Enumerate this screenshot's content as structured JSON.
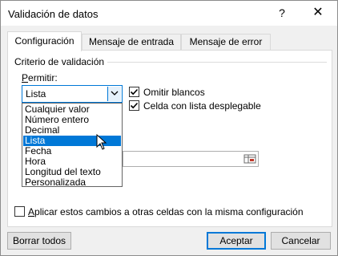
{
  "window": {
    "title": "Validación de datos",
    "help_label": "?",
    "close_label": "✕"
  },
  "tabs": [
    {
      "label": "Configuración",
      "active": true
    },
    {
      "label": "Mensaje de entrada",
      "active": false
    },
    {
      "label": "Mensaje de error",
      "active": false
    }
  ],
  "criteria": {
    "group_label": "Criterio de validación",
    "permit_label_underlined": "P",
    "permit_label_rest": "ermitir:",
    "permit_value": "Lista",
    "options": [
      {
        "label": "Cualquier valor",
        "selected": false
      },
      {
        "label": "Número entero",
        "selected": false
      },
      {
        "label": "Decimal",
        "selected": false
      },
      {
        "label": "Lista",
        "selected": true
      },
      {
        "label": "Fecha",
        "selected": false
      },
      {
        "label": "Hora",
        "selected": false
      },
      {
        "label": "Longitud del texto",
        "selected": false
      },
      {
        "label": "Personalizada",
        "selected": false
      }
    ],
    "ignore_blank": {
      "label": "Omitir blancos",
      "checked": true
    },
    "in_cell_dropdown": {
      "label": "Celda con lista desplegable",
      "checked": true
    },
    "source_value": ""
  },
  "apply_all": {
    "label_underlined": "A",
    "label_rest": "plicar estos cambios a otras celdas con la misma configuración",
    "checked": false
  },
  "buttons": {
    "clear_all": "Borrar todos",
    "ok": "Aceptar",
    "cancel": "Cancelar"
  },
  "colors": {
    "selection": "#0078d7",
    "dialog_bg": "#f0f0f0"
  }
}
